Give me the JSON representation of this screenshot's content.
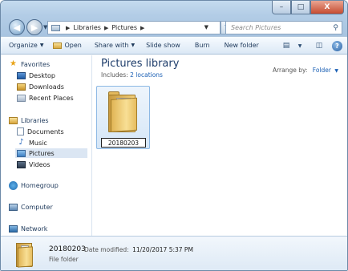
{
  "window": {
    "controls": {
      "minimize": "–",
      "maximize": "□",
      "close": "X"
    }
  },
  "navigation": {
    "back_glyph": "◀",
    "forward_glyph": "▶",
    "breadcrumb": [
      "Libraries",
      "Pictures"
    ],
    "separator": "▶",
    "refresh_glyph": "↻",
    "search_placeholder": "Search Pictures",
    "search_glyph": "⚲"
  },
  "toolbar": {
    "organize": "Organize",
    "open": "Open",
    "share_with": "Share with",
    "slide_show": "Slide show",
    "burn": "Burn",
    "new_folder": "New folder",
    "view_glyph": "▤",
    "preview_glyph": "◫",
    "help_glyph": "?"
  },
  "sidebar": {
    "favorites": "Favorites",
    "favorites_items": [
      "Desktop",
      "Downloads",
      "Recent Places"
    ],
    "libraries": "Libraries",
    "libraries_items": [
      "Documents",
      "Music",
      "Pictures",
      "Videos"
    ],
    "homegroup": "Homegroup",
    "computer": "Computer",
    "network": "Network",
    "selected": "Pictures"
  },
  "main": {
    "title": "Pictures library",
    "includes_label": "Includes:",
    "includes_link": "2 locations",
    "arrange_label": "Arrange by:",
    "arrange_value": "Folder",
    "items": [
      {
        "name": "20180203",
        "type": "folder",
        "renaming": true
      }
    ]
  },
  "details": {
    "name": "20180203",
    "date_label": "Date modified:",
    "date_value": "11/20/2017 5:37 PM",
    "type": "File folder"
  },
  "colors": {
    "accent": "#1a5fb4",
    "title": "#1e3d6b",
    "selection": "#dbe6f3"
  }
}
